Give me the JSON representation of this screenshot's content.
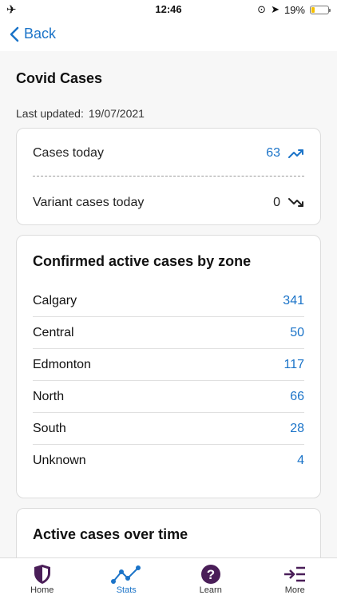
{
  "status_bar": {
    "time": "12:46",
    "battery": "19%",
    "battery_level": 0.19
  },
  "nav": {
    "back_label": "Back"
  },
  "page": {
    "title": "Covid Cases",
    "updated_label": "Last updated:",
    "updated_value": "19/07/2021"
  },
  "summary": {
    "cases_today_label": "Cases today",
    "cases_today_value": "63",
    "variant_label": "Variant cases today",
    "variant_value": "0"
  },
  "zones": {
    "title": "Confirmed active cases by zone",
    "rows": [
      {
        "name": "Calgary",
        "value": "341"
      },
      {
        "name": "Central",
        "value": "50"
      },
      {
        "name": "Edmonton",
        "value": "117"
      },
      {
        "name": "North",
        "value": "66"
      },
      {
        "name": "South",
        "value": "28"
      },
      {
        "name": "Unknown",
        "value": "4"
      }
    ]
  },
  "over_time": {
    "title": "Active cases over time"
  },
  "tabs": [
    {
      "label": "Home",
      "icon": "shield-icon"
    },
    {
      "label": "Stats",
      "icon": "stats-icon"
    },
    {
      "label": "Learn",
      "icon": "help-icon"
    },
    {
      "label": "More",
      "icon": "more-icon"
    }
  ],
  "colors": {
    "accent": "#1a73c8",
    "brand": "#4a1e58"
  }
}
